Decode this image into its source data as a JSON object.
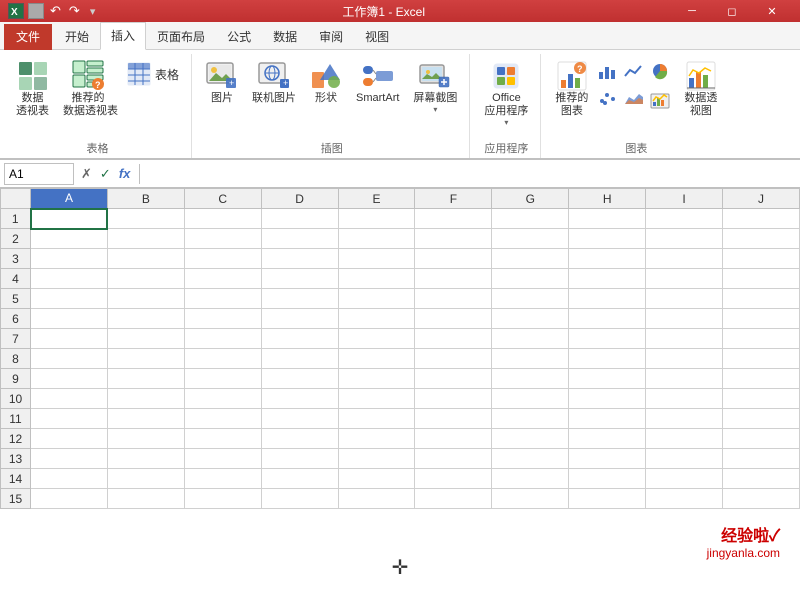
{
  "titleBar": {
    "appIcon": "X",
    "title": "工作簿1 - Excel",
    "undoLabel": "↩",
    "redoLabel": "↪"
  },
  "ribbonTabs": [
    {
      "id": "file",
      "label": "文件",
      "active": false
    },
    {
      "id": "home",
      "label": "开始",
      "active": false
    },
    {
      "id": "insert",
      "label": "插入",
      "active": true
    },
    {
      "id": "pagelayout",
      "label": "页面布局",
      "active": false
    },
    {
      "id": "formulas",
      "label": "公式",
      "active": false
    },
    {
      "id": "data",
      "label": "数据",
      "active": false
    },
    {
      "id": "review",
      "label": "审阅",
      "active": false
    },
    {
      "id": "view",
      "label": "视图",
      "active": false
    }
  ],
  "ribbonGroups": {
    "tables": {
      "label": "表格",
      "buttons": [
        {
          "id": "pivot-table",
          "label": "数据\n透视表",
          "icon": "📊"
        },
        {
          "id": "recommend-pivot",
          "label": "推荐的\n数据透视表",
          "icon": "📋"
        }
      ],
      "smallButtons": [
        {
          "id": "table",
          "label": "表格",
          "icon": "⊞"
        }
      ]
    },
    "illustrations": {
      "label": "插图",
      "buttons": [
        {
          "id": "pictures",
          "label": "图片",
          "icon": "🖼"
        },
        {
          "id": "online-pictures",
          "label": "联机图片",
          "icon": "🌐"
        },
        {
          "id": "shapes",
          "label": "形状",
          "icon": "🔷"
        },
        {
          "id": "smartart",
          "label": "SmartArt",
          "icon": "🔵"
        },
        {
          "id": "screenshot",
          "label": "屏幕截图",
          "icon": "📷"
        }
      ]
    },
    "apps": {
      "label": "应用程序",
      "buttons": [
        {
          "id": "office-apps",
          "label": "Office\n应用程序",
          "icon": "🔷"
        },
        {
          "id": "recommend-apps",
          "label": "推荐的\n图表",
          "icon": "📊"
        }
      ]
    },
    "charts": {
      "label": "图表",
      "buttons": [
        {
          "id": "charts",
          "label": "数据透\n视图",
          "icon": "📈"
        }
      ]
    }
  },
  "formulaBar": {
    "cellRef": "A1",
    "cancelLabel": "✗",
    "confirmLabel": "✓",
    "functionLabel": "fx",
    "formula": ""
  },
  "columns": [
    "A",
    "B",
    "C",
    "D",
    "E",
    "F",
    "G",
    "H",
    "I",
    "J"
  ],
  "rows": [
    1,
    2,
    3,
    4,
    5,
    6,
    7,
    8,
    9,
    10,
    11,
    12,
    13,
    14,
    15
  ],
  "activeCell": "A1",
  "watermark": {
    "text": "经验啦✓",
    "url": "jingyanla.com"
  }
}
